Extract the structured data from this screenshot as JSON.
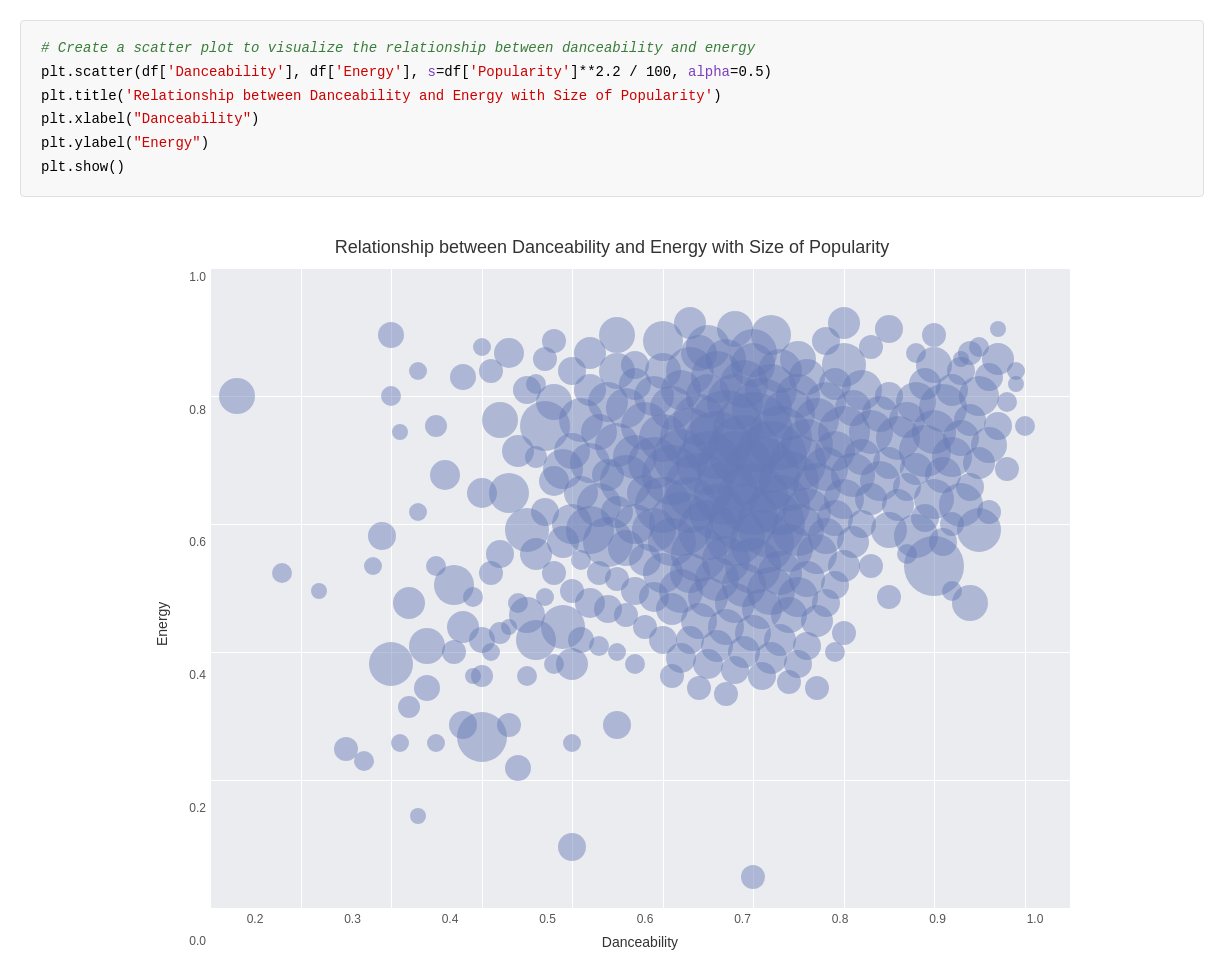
{
  "code": {
    "comment": "# Create a scatter plot to visualize the relationship between danceability and energy",
    "line1_prefix": "plt.scatter(df[",
    "line1_str1": "'Danceability'",
    "line1_mid1": "], df[",
    "line1_str2": "'Energy'",
    "line1_mid2": "], ",
    "line1_param1": "s",
    "line1_eq1": "=df[",
    "line1_str3": "'Popularity'",
    "line1_rest": "]**2.2 / 100, ",
    "line1_param2": "alpha",
    "line1_eq2": "=0.5)",
    "line2_prefix": "plt.title(",
    "line2_str": "'Relationship between Danceability and Energy with Size of Popularity'",
    "line2_suffix": ")",
    "line3_prefix": "plt.xlabel(",
    "line3_str": "\"Danceability\"",
    "line3_suffix": ")",
    "line4_prefix": "plt.ylabel(",
    "line4_str": "\"Energy\"",
    "line4_suffix": ")",
    "line5": "plt.show()"
  },
  "chart": {
    "title": "Relationship between Danceability and Energy with Size of Popularity",
    "x_label": "Danceability",
    "y_label": "Energy",
    "x_ticks": [
      "0.2",
      "0.3",
      "0.4",
      "0.5",
      "0.6",
      "0.7",
      "0.8",
      "0.9",
      "1.0"
    ],
    "y_ticks": [
      "0.2",
      "0.4",
      "0.6",
      "0.8"
    ]
  }
}
